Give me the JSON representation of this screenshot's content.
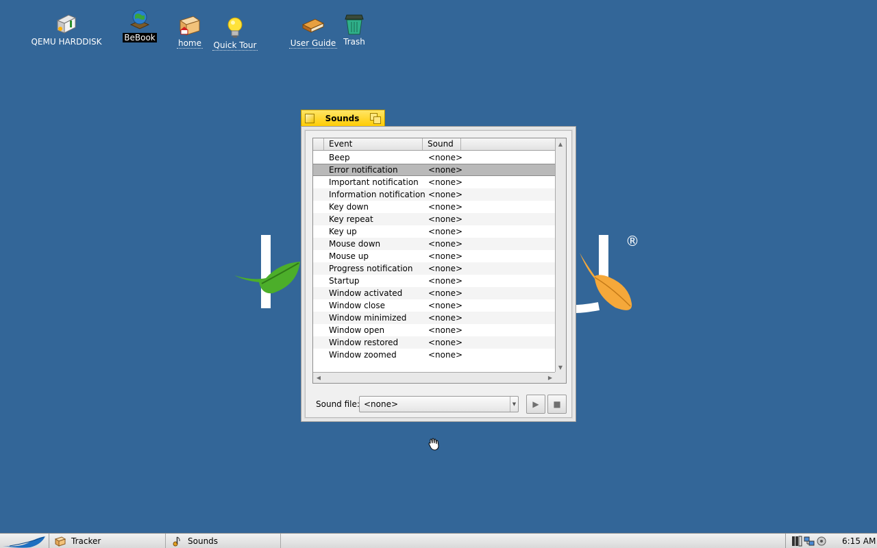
{
  "desktop": {
    "icons": [
      {
        "name": "qemu-harddisk",
        "label": "QEMU HARDDISK",
        "icon": "harddisk-icon"
      },
      {
        "name": "bebook",
        "label": "BeBook",
        "icon": "globe-book-icon"
      },
      {
        "name": "home",
        "label": "home",
        "icon": "home-folder-icon"
      },
      {
        "name": "quick-tour",
        "label": "Quick Tour",
        "icon": "lightbulb-icon"
      },
      {
        "name": "user-guide",
        "label": "User Guide",
        "icon": "book-icon"
      },
      {
        "name": "trash",
        "label": "Trash",
        "icon": "trash-icon"
      }
    ],
    "logo_registered": "®"
  },
  "window": {
    "title": "Sounds",
    "columns": [
      "Event",
      "Sound"
    ],
    "rows": [
      {
        "event": "Beep",
        "sound": "<none>"
      },
      {
        "event": "Error notification",
        "sound": "<none>",
        "selected": true
      },
      {
        "event": "Important notification",
        "sound": "<none>"
      },
      {
        "event": "Information notification",
        "sound": "<none>"
      },
      {
        "event": "Key down",
        "sound": "<none>"
      },
      {
        "event": "Key repeat",
        "sound": "<none>"
      },
      {
        "event": "Key up",
        "sound": "<none>"
      },
      {
        "event": "Mouse down",
        "sound": "<none>"
      },
      {
        "event": "Mouse up",
        "sound": "<none>"
      },
      {
        "event": "Progress notification",
        "sound": "<none>"
      },
      {
        "event": "Startup",
        "sound": "<none>"
      },
      {
        "event": "Window activated",
        "sound": "<none>"
      },
      {
        "event": "Window close",
        "sound": "<none>"
      },
      {
        "event": "Window minimized",
        "sound": "<none>"
      },
      {
        "event": "Window open",
        "sound": "<none>"
      },
      {
        "event": "Window restored",
        "sound": "<none>"
      },
      {
        "event": "Window zoomed",
        "sound": "<none>"
      }
    ],
    "sound_file_label": "Sound file:",
    "sound_file_value": "<none>"
  },
  "deskbar": {
    "tasks": [
      {
        "label": "Tracker",
        "icon": "tracker-icon"
      },
      {
        "label": "Sounds",
        "icon": "sounds-icon"
      }
    ],
    "clock": "6:15 AM"
  },
  "colors": {
    "desktop": "#336698",
    "tab": "#ffcb00",
    "leaf_green": "#4cae2a",
    "leaf_orange": "#f5a83a"
  }
}
